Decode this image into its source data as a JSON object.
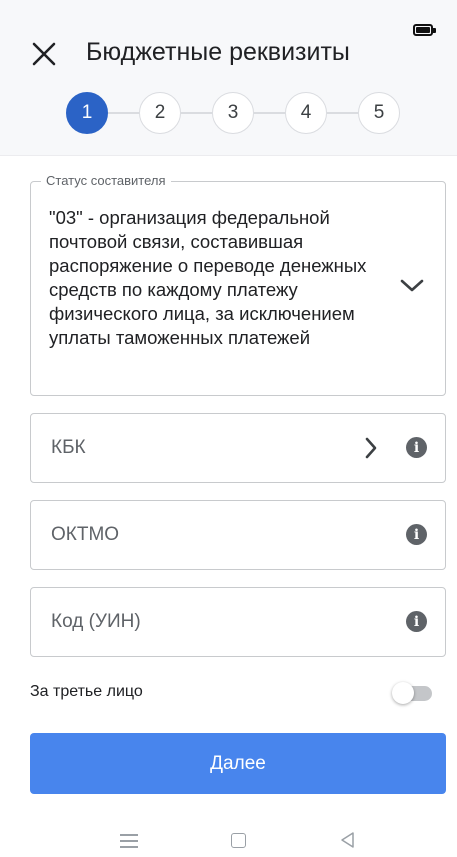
{
  "header": {
    "title": "Бюджетные реквизиты",
    "steps": [
      {
        "label": "1",
        "active": true
      },
      {
        "label": "2",
        "active": false
      },
      {
        "label": "3",
        "active": false
      },
      {
        "label": "4",
        "active": false
      },
      {
        "label": "5",
        "active": false
      }
    ]
  },
  "form": {
    "status": {
      "label": "Статус составителя",
      "value": "\"03\" - организация федеральной почтовой связи, составившая распоряжение о переводе денежных средств по каждому платежу физического лица, за исключением уплаты таможенных платежей"
    },
    "kbk": {
      "placeholder": "КБК"
    },
    "oktmo": {
      "placeholder": "ОКТМО"
    },
    "uin": {
      "placeholder": "Код (УИН)"
    },
    "third_party": {
      "label": "За третье лицо",
      "checked": false
    }
  },
  "actions": {
    "next_label": "Далее"
  },
  "colors": {
    "accent": "#2b63c6",
    "button": "#4885ed",
    "border": "#c8cacd",
    "header_bg": "#f7f8fa"
  },
  "icons": [
    "battery-icon",
    "close-icon",
    "chevron-down-icon",
    "chevron-right-icon",
    "info-icon",
    "menu-icon",
    "home-icon",
    "back-icon"
  ]
}
